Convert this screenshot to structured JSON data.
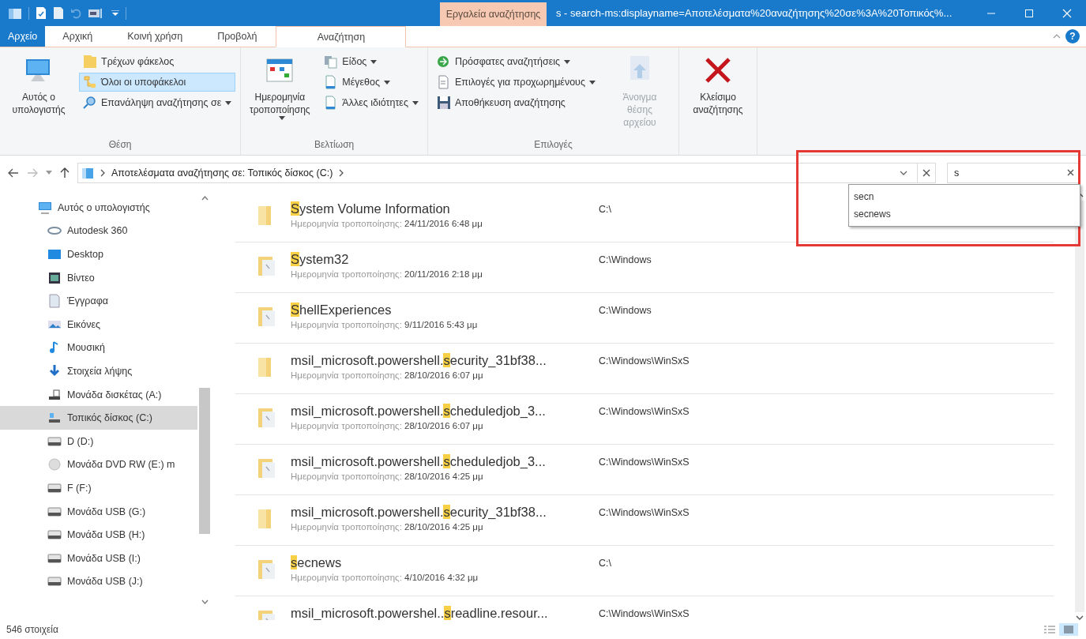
{
  "title_bar": {
    "context_tab": "Εργαλεία αναζήτησης",
    "title": "s - search-ms:displayname=Αποτελέσματα%20αναζήτησης%20σε%3A%20Τοπικός%..."
  },
  "ribbon_tabs": [
    {
      "label": "Αρχείο",
      "kind": "file",
      "selected": false
    },
    {
      "label": "Αρχική",
      "kind": "tab",
      "selected": false
    },
    {
      "label": "Κοινή χρήση",
      "kind": "tab",
      "selected": false
    },
    {
      "label": "Προβολή",
      "kind": "tab",
      "selected": false
    },
    {
      "label": "Αναζήτηση",
      "kind": "tab",
      "selected": true
    }
  ],
  "help": "?",
  "ribbon_groups": [
    {
      "label": "Θέση",
      "items": [
        {
          "kind": "large",
          "label": "Αυτός ο υπολογιστής",
          "dropdown": false,
          "disabled": false
        },
        {
          "kind": "small",
          "label": "Τρέχων φάκελος",
          "dropdown": false,
          "selected": false
        },
        {
          "kind": "small",
          "label": "Όλοι οι υποφάκελοι",
          "dropdown": false,
          "selected": true
        },
        {
          "kind": "small",
          "label": "Επανάληψη αναζήτησης σε",
          "dropdown": true,
          "selected": false
        }
      ]
    },
    {
      "label": "Βελτίωση",
      "items": [
        {
          "kind": "large",
          "label": "Ημερομηνία τροποποίησης",
          "dropdown": true,
          "disabled": false
        },
        {
          "kind": "small",
          "label": "Είδος",
          "dropdown": true,
          "selected": false
        },
        {
          "kind": "small",
          "label": "Μέγεθος",
          "dropdown": true,
          "selected": false
        },
        {
          "kind": "small",
          "label": "Άλλες ιδιότητες",
          "dropdown": true,
          "selected": false
        }
      ]
    },
    {
      "label": "Επιλογές",
      "items": [
        {
          "kind": "small",
          "label": "Πρόσφατες αναζητήσεις",
          "dropdown": true,
          "selected": false
        },
        {
          "kind": "small",
          "label": "Επιλογές για προχωρημένους",
          "dropdown": true,
          "selected": false
        },
        {
          "kind": "small",
          "label": "Αποθήκευση αναζήτησης",
          "dropdown": false,
          "selected": false
        },
        {
          "kind": "large",
          "label": "Άνοιγμα θέσης αρχείου",
          "dropdown": false,
          "disabled": true
        }
      ]
    },
    {
      "items": [
        {
          "kind": "large",
          "label": "Κλείσιμο αναζήτησης",
          "dropdown": false,
          "disabled": false
        }
      ]
    }
  ],
  "address_bar": {
    "path": "Αποτελέσματα αναζήτησης σε: Τοπικός δίσκος (C:)"
  },
  "search": {
    "value": "s",
    "suggestions": [
      "secn",
      "secnews"
    ]
  },
  "annotation": {
    "color": "#e53935"
  },
  "nav_pane": [
    {
      "label": "Αυτός ο υπολογιστής",
      "selected": false,
      "children": [
        {
          "label": "Autodesk 360",
          "selected": false
        },
        {
          "label": "Desktop",
          "selected": false
        },
        {
          "label": "Βίντεο",
          "selected": false
        },
        {
          "label": "Έγγραφα",
          "selected": false
        },
        {
          "label": "Εικόνες",
          "selected": false
        },
        {
          "label": "Μουσική",
          "selected": false
        },
        {
          "label": "Στοιχεία λήψης",
          "selected": false
        },
        {
          "label": "Μονάδα δισκέτας (A:)",
          "selected": false
        },
        {
          "label": "Τοπικός δίσκος (C:)",
          "selected": true
        },
        {
          "label": "D (D:)",
          "selected": false
        },
        {
          "label": "Μονάδα DVD RW (E:) m",
          "selected": false
        },
        {
          "label": "F (F:)",
          "selected": false
        },
        {
          "label": "Μονάδα USB (G:)",
          "selected": false
        },
        {
          "label": "Μονάδα USB (H:)",
          "selected": false
        },
        {
          "label": "Μονάδα USB (I:)",
          "selected": false
        },
        {
          "label": "Μονάδα USB (J:)",
          "selected": false
        }
      ]
    }
  ],
  "results": [
    {
      "match": "S",
      "after": "ystem Volume Information",
      "date_label": "Ημερομηνία τροποποίησης:",
      "date": "24/11/2016 6:48 μμ",
      "location": "C:\\"
    },
    {
      "match": "S",
      "after": "ystem32",
      "date_label": "Ημερομηνία τροποποίησης:",
      "date": "20/11/2016 2:18 μμ",
      "location": "C:\\Windows"
    },
    {
      "match": "S",
      "after": "hellExperiences",
      "date_label": "Ημερομηνία τροποποίησης:",
      "date": "9/11/2016 5:43 μμ",
      "location": "C:\\Windows"
    },
    {
      "before": "msil_microsoft.powershell.",
      "match": "s",
      "after": "ecurity_31bf38...",
      "date_label": "Ημερομηνία τροποποίησης:",
      "date": "28/10/2016 6:07 μμ",
      "location": "C:\\Windows\\WinSxS"
    },
    {
      "before": "msil_microsoft.powershell.",
      "match": "s",
      "after": "cheduledjob_3...",
      "date_label": "Ημερομηνία τροποποίησης:",
      "date": "28/10/2016 6:07 μμ",
      "location": "C:\\Windows\\WinSxS"
    },
    {
      "before": "msil_microsoft.powershell.",
      "match": "s",
      "after": "cheduledjob_3...",
      "date_label": "Ημερομηνία τροποποίησης:",
      "date": "28/10/2016 4:25 μμ",
      "location": "C:\\Windows\\WinSxS"
    },
    {
      "before": "msil_microsoft.powershell.",
      "match": "s",
      "after": "ecurity_31bf38...",
      "date_label": "Ημερομηνία τροποποίησης:",
      "date": "28/10/2016 4:25 μμ",
      "location": "C:\\Windows\\WinSxS"
    },
    {
      "match": "s",
      "after": "ecnews",
      "date_label": "Ημερομηνία τροποποίησης:",
      "date": "4/10/2016 4:32 μμ",
      "location": "C:\\"
    },
    {
      "before": "msil_microsoft.powershel..",
      "match": "s",
      "after": "readline.resour...",
      "location": "C:\\Windows\\WinSxS"
    }
  ],
  "status_bar": {
    "count": "546 στοιχεία"
  }
}
